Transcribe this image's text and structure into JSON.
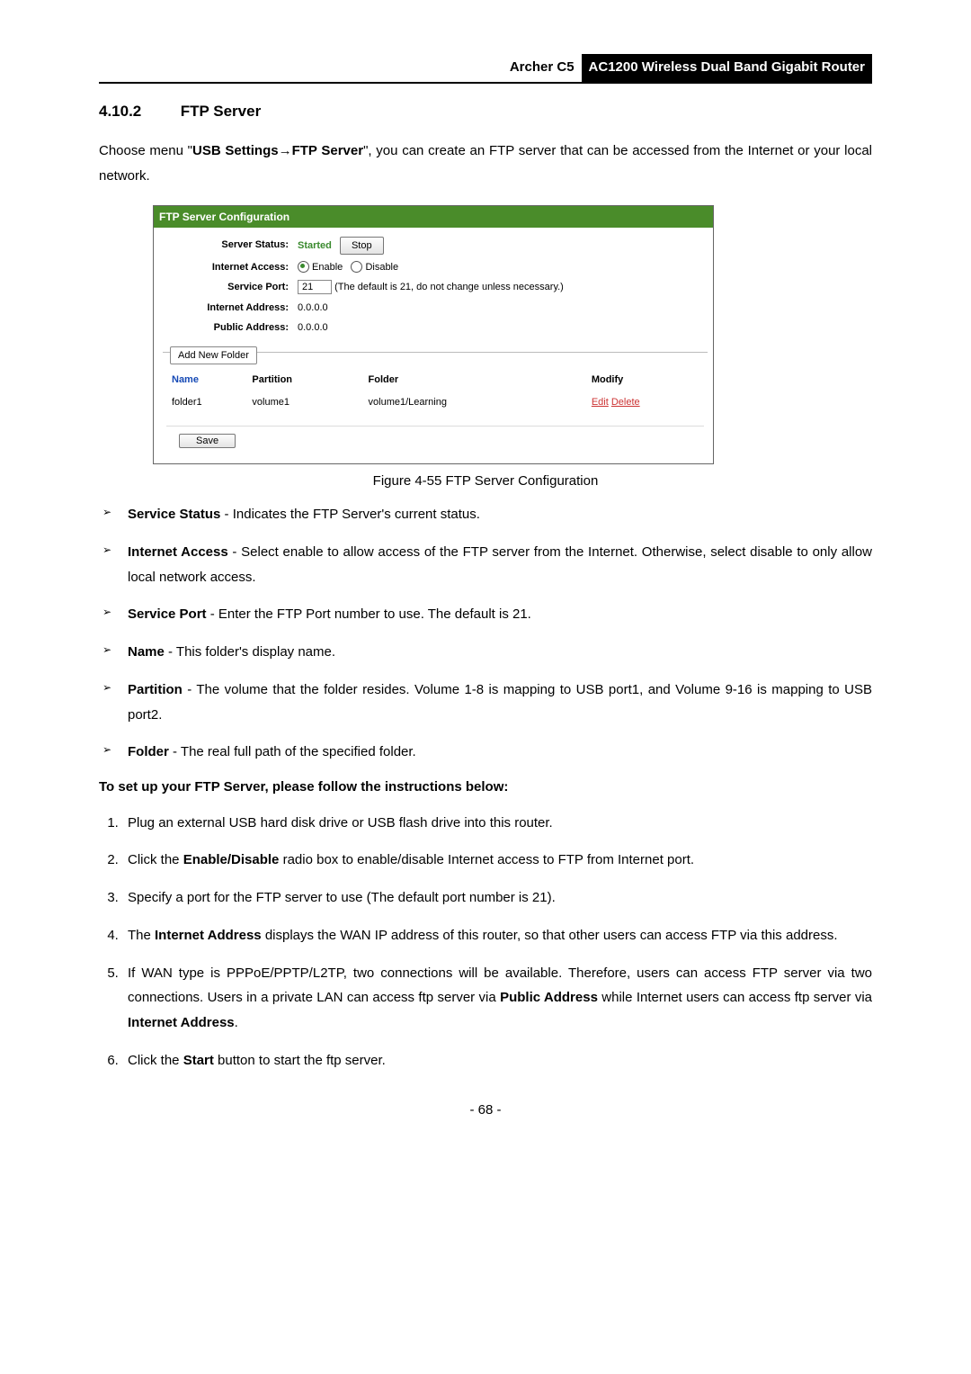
{
  "header": {
    "model": "Archer C5",
    "product": "AC1200 Wireless Dual Band Gigabit Router"
  },
  "section": {
    "number": "4.10.2",
    "title": "FTP Server"
  },
  "intro": {
    "prefix": "Choose menu \"",
    "menu1": "USB Settings",
    "arrow": "→",
    "menu2": "FTP Server",
    "suffix": "\", you can create an FTP server that can be accessed from the Internet or your local network."
  },
  "shot": {
    "title": "FTP Server Configuration",
    "rows": {
      "server_status_label": "Server Status:",
      "server_status_val": "Started",
      "stop_btn": "Stop",
      "internet_access_label": "Internet Access:",
      "enable": "Enable",
      "disable": "Disable",
      "service_port_label": "Service Port:",
      "port_val": "21",
      "port_note": "(The default is 21, do not change unless necessary.)",
      "internet_addr_label": "Internet Address:",
      "internet_addr_val": "0.0.0.0",
      "public_addr_label": "Public Address:",
      "public_addr_val": "0.0.0.0"
    },
    "add_folder": "Add New Folder",
    "table": {
      "h_name": "Name",
      "h_partition": "Partition",
      "h_folder": "Folder",
      "h_modify": "Modify",
      "rows": [
        {
          "name": "folder1",
          "partition": "volume1",
          "folder": "volume1/Learning",
          "edit": "Edit",
          "delete": "Delete"
        }
      ]
    },
    "save": "Save"
  },
  "caption": "Figure 4-55 FTP Server Configuration",
  "bullets": [
    {
      "term": "Service Status",
      "desc": " - Indicates the FTP Server's current status."
    },
    {
      "term": "Internet Access",
      "desc": " - Select enable to allow access of the FTP server from the Internet. Otherwise, select disable to only allow local network access."
    },
    {
      "term": "Service Port",
      "desc": " - Enter the FTP Port number to use. The default is 21."
    },
    {
      "term": "Name",
      "desc": " - This folder's display name."
    },
    {
      "term": "Partition",
      "desc": " - The volume that the folder resides. Volume 1-8 is mapping to USB port1, and Volume 9-16 is mapping to USB port2."
    },
    {
      "term": "Folder",
      "desc": " - The real full path of the specified folder."
    }
  ],
  "instr_head": "To set up your FTP Server, please follow the instructions below:",
  "steps": {
    "s1": "Plug an external USB hard disk drive or USB flash drive into this router.",
    "s2_a": "Click the ",
    "s2_b": "Enable/Disable",
    "s2_c": " radio box to enable/disable Internet access to FTP from Internet port.",
    "s3": "Specify a port for the FTP server to use (The default port number is 21).",
    "s4_a": "The ",
    "s4_b": "Internet Address",
    "s4_c": " displays the WAN IP address of this router, so that other users can access FTP via this address.",
    "s5_a": "If WAN type is PPPoE/PPTP/L2TP, two connections will be available. Therefore, users can access FTP server via two connections. Users in a private LAN can access ftp server via ",
    "s5_b": "Public Address",
    "s5_c": " while Internet users can access ftp server via ",
    "s5_d": "Internet Address",
    "s5_e": ".",
    "s6_a": "Click the ",
    "s6_b": "Start",
    "s6_c": " button to start the ftp server."
  },
  "page_number": "- 68 -"
}
